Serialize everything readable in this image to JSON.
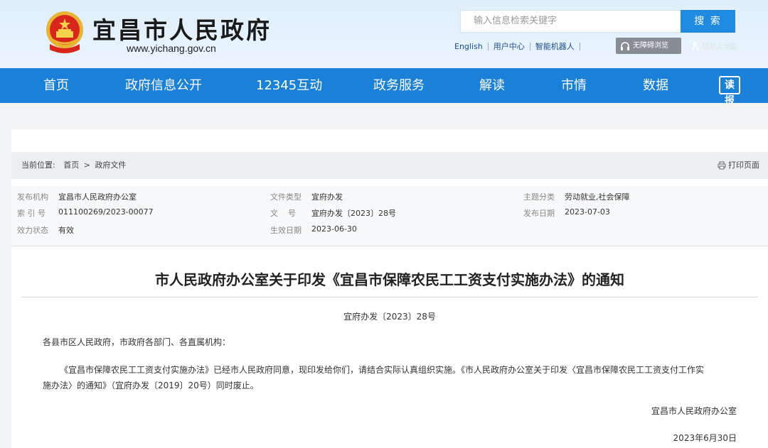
{
  "header": {
    "site_name": "宜昌市人民政府",
    "domain": "www.yichang.gov.cn",
    "search_placeholder": "输入信息检索关键字",
    "search_button": "搜 索",
    "links": [
      "English",
      "用户中心",
      "智能机器人"
    ],
    "accessibility": "无障碍浏览",
    "elder_zone": "老年人专区"
  },
  "nav": {
    "items": [
      "首页",
      "政府信息公开",
      "12345互动",
      "政务服务",
      "解读",
      "市情",
      "数据"
    ],
    "badge": "读报"
  },
  "breadcrumb": {
    "label": "当前位置:",
    "home": "首页",
    "sep": ">",
    "current": "政府文件",
    "print": "打印页面"
  },
  "meta": [
    {
      "key": "发布机构",
      "value": "宜昌市人民政府办公室"
    },
    {
      "key": "文件类型",
      "value": "宜府办发"
    },
    {
      "key": "主题分类",
      "value": "劳动就业,社会保障"
    },
    {
      "key": "索 引 号",
      "value": "011100269/2023-00077"
    },
    {
      "key": "文    号",
      "value": "宜府办发〔2023〕28号"
    },
    {
      "key": "发布日期",
      "value": "2023-07-03"
    },
    {
      "key": "效力状态",
      "value": "有效"
    },
    {
      "key": "生效日期",
      "value": "2023-06-30"
    }
  ],
  "document": {
    "title": "市人民政府办公室关于印发《宜昌市保障农民工工资支付实施办法》的通知",
    "number": "宜府办发〔2023〕28号",
    "salutation": "各县市区人民政府，市政府各部门、各直属机构：",
    "body_line1": "《宜昌市保障农民工工资支付实施办法》已经市人民政府同意，现印发给你们，请结合实际认真组织实施。《市人民政府办公室关于印发〈宜昌市保障农民工工资支付工作实",
    "body_line2": "施办法〉的通知》（宜府办发〔2019〕20号）同时废止。",
    "signatory": "宜昌市人民政府办公室",
    "date": "2023年6月30日"
  },
  "colors": {
    "nav": "#1a80d8",
    "search_button": "#1f8be0",
    "header_bg": "#dfeefb"
  }
}
